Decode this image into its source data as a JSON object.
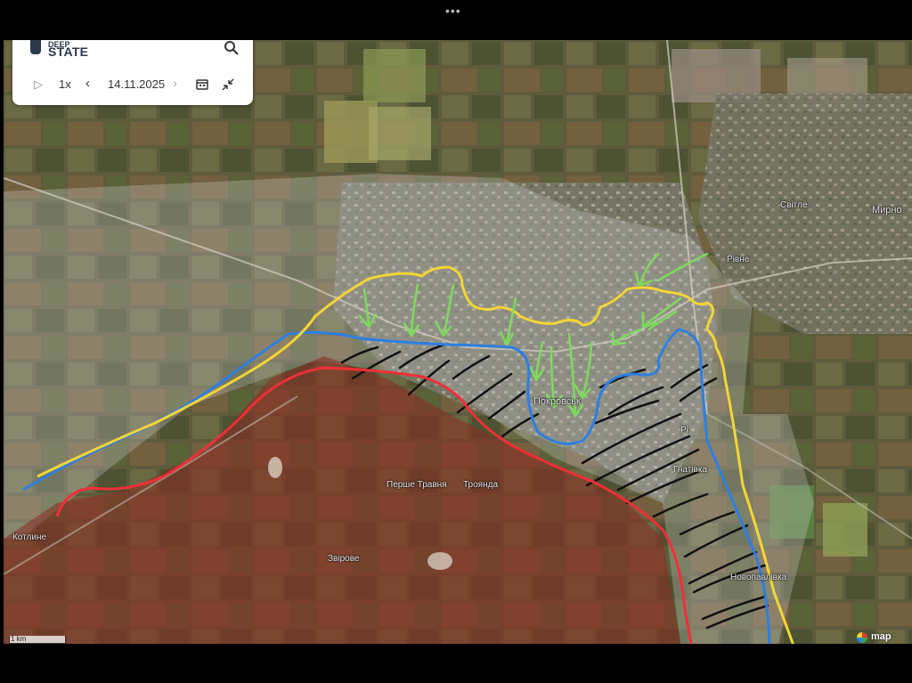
{
  "app": {
    "logo_top": "DEEP",
    "logo": "STATE",
    "icons": {
      "search": "search-icon",
      "play": "play-icon",
      "prev": "chevron-left-icon",
      "next": "chevron-right-icon",
      "calendar": "calendar-icon",
      "collapse": "collapse-icon"
    }
  },
  "timeline": {
    "speed": "1x",
    "date": "14.11.2025"
  },
  "map": {
    "labels": {
      "svitle": "Світле",
      "myrnohrad": "Мирно",
      "rivne": "Рівне",
      "pokrovsk": "Покровськ",
      "pokrovsk_suffix": "Рі",
      "pershe_travnia": "Перше Травня",
      "troianda": "Троянда",
      "hnativka": "Гнатівка",
      "kotlyne": "Котлине",
      "zvirove": "Звірове",
      "novopavlivka": "Новопавлівка"
    },
    "scale": "1 km",
    "attribution": "map",
    "colors": {
      "yellow_line": "#f5d435",
      "blue_line": "#2d7fe0",
      "red_line": "#ef2f37",
      "arrows": "#7cdc5a",
      "hatch": "#111111",
      "occupied_fill": "#8a2a20",
      "gray_zone": "#c8c8c8"
    }
  }
}
